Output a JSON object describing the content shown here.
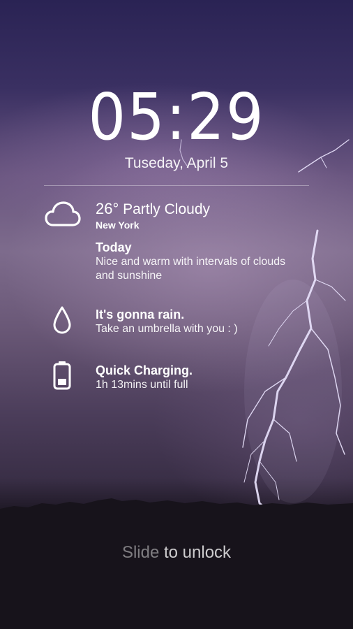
{
  "lockscreen": {
    "time": "05:29",
    "date": "Tuseday, April 5"
  },
  "weather": {
    "icon": "cloud-icon",
    "temperature": "26°",
    "condition": "Partly Cloudy",
    "city": "New York"
  },
  "forecast": {
    "title": "Today",
    "description": "Nice and warm with intervals of clouds and sunshine"
  },
  "rain_alert": {
    "icon": "raindrop-icon",
    "title": "It's gonna rain.",
    "message": "Take an umbrella with you : )"
  },
  "battery": {
    "icon": "battery-icon",
    "title": "Quick Charging.",
    "status": "1h 13mins until full"
  },
  "unlock": {
    "prefix": "Slide",
    "suffix": " to unlock"
  }
}
